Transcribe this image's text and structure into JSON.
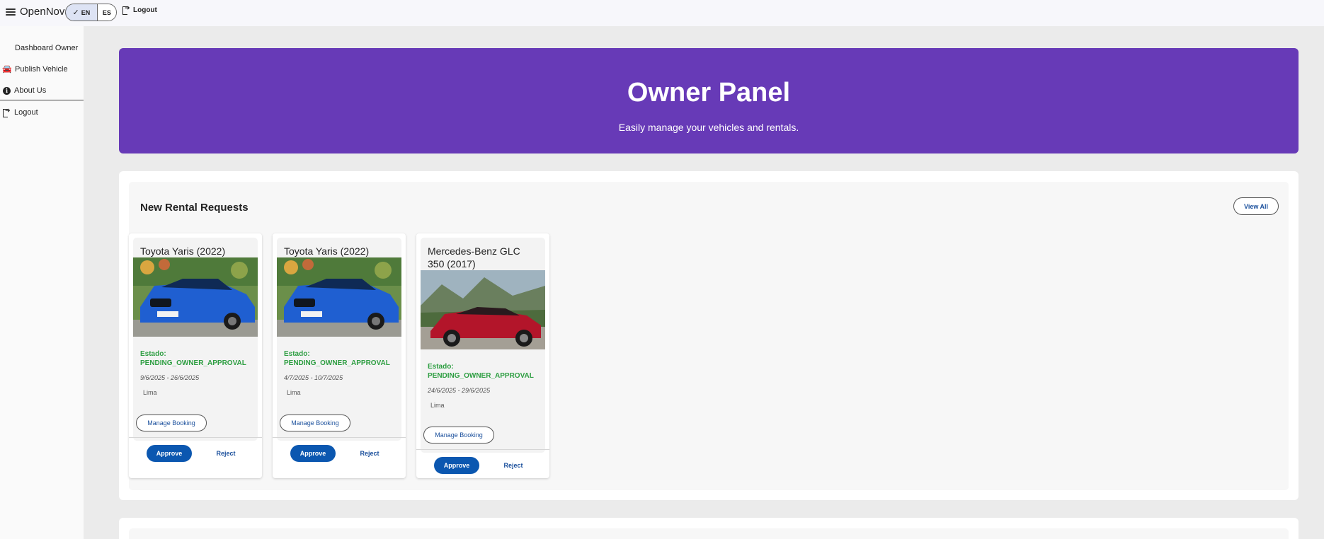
{
  "topbar": {
    "app_title": "OpenNova",
    "lang_en": "EN",
    "lang_es": "ES",
    "logout": "Logout"
  },
  "sidebar": {
    "items": [
      {
        "label": "Dashboard Owner",
        "icon": "dashboard-icon"
      },
      {
        "label": "Publish Vehicle",
        "icon": "car-icon"
      },
      {
        "label": "About Us",
        "icon": "info-icon"
      },
      {
        "label": "Logout",
        "icon": "logout-icon"
      }
    ]
  },
  "hero": {
    "title": "Owner Panel",
    "subtitle": "Easily manage your vehicles and rentals."
  },
  "requests": {
    "title": "New Rental Requests",
    "view_all": "View All",
    "cards": [
      {
        "title": "Toyota Yaris (2022)",
        "status_label": "Estado:",
        "status": "PENDING_OWNER_APPROVAL",
        "dates": "9/6/2025 - 26/6/2025",
        "location": "Lima",
        "manage": "Manage Booking",
        "approve": "Approve",
        "reject": "Reject"
      },
      {
        "title": "Toyota Yaris (2022)",
        "status_label": "Estado:",
        "status": "PENDING_OWNER_APPROVAL",
        "dates": "4/7/2025 - 10/7/2025",
        "location": "Lima",
        "manage": "Manage Booking",
        "approve": "Approve",
        "reject": "Reject"
      },
      {
        "title": "Mercedes-Benz GLC 350 (2017)",
        "status_label": "Estado:",
        "status": "PENDING_OWNER_APPROVAL",
        "dates": "24/6/2025 - 29/6/2025",
        "location": "Lima",
        "manage": "Manage Booking",
        "approve": "Approve",
        "reject": "Reject"
      }
    ]
  },
  "colors": {
    "hero_bg": "#673ab7",
    "status_green": "#2e9e42",
    "approve_blue": "#0b57b0",
    "link_blue": "#1a4f9c"
  }
}
